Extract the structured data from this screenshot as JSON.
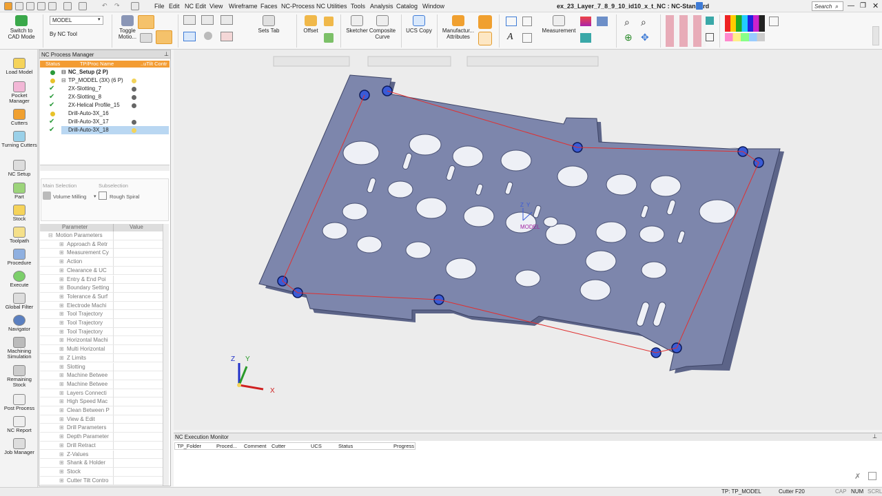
{
  "titlebar": {
    "menu": [
      "File",
      "Edit",
      "NC Edit",
      "View",
      "Wireframe",
      "Faces",
      "NC-Process",
      "NC Utilities",
      "Tools",
      "Analysis",
      "Catalog",
      "Window"
    ],
    "title": "ex_23_Layer_7_8_9_10_id10_x_t_NC : NC-Standard",
    "search_placeholder": "Search"
  },
  "ribbon": {
    "switch_cad": "Switch to CAD Mode",
    "model_select": "MODEL",
    "by_nc_tool": "By NC Tool",
    "toggle_motion": "Toggle Motio...",
    "sets_tab": "Sets Tab",
    "offset": "Offset",
    "sketcher": "Sketcher",
    "composite_curve": "Composite Curve",
    "ucs_copy": "UCS Copy",
    "manufacturing_attributes": "Manufactur... Attributes",
    "measurement": "Measurement"
  },
  "leftbar": [
    "Load Model",
    "Pocket Manager",
    "Cutters",
    "Turning Cutters",
    "NC Setup",
    "Part",
    "Stock",
    "Toolpath",
    "Procedure",
    "Execute",
    "Global Filter",
    "Navigator",
    "Machining Simulation",
    "Remaining Stock",
    "Post Process",
    "NC Report",
    "Job Manager"
  ],
  "process_manager": {
    "title": "NC Process Manager",
    "columns": [
      "Status",
      "TP/Proc Name",
      "..uTilt Contr"
    ],
    "rows": [
      "NC_Setup (2 P)",
      "TP_MODEL (3X) (6 P)",
      "2X-Slotting_7",
      "2X-Slotting_8",
      "2X-Helical Profile_15",
      "Drill-Auto-3X_16",
      "Drill-Auto-3X_17",
      "Drill-Auto-3X_18"
    ]
  },
  "selection": {
    "main_label": "Main Selection",
    "main_value": "Volume Milling",
    "sub_label": "Subselection",
    "sub_value": "Rough Spiral"
  },
  "params": {
    "columns": [
      "Parameter",
      "Value"
    ],
    "items": [
      "Motion Parameters",
      "Approach & Retr",
      "Measurement Cy",
      "Action",
      "Clearance & UC",
      "Entry & End Poi",
      "Boundary Setting",
      "Tolerance & Surf",
      "Electrode Machi",
      "Tool Trajectory",
      "Tool Trajectory",
      "Tool Trajectory",
      "Horizontal Machi",
      "Multi Horizontal",
      "Z Limits",
      "Slotting",
      "Machine Betwee",
      "Machine Betwee",
      "Layers Connecti",
      "High Speed Mac",
      "Clean Between P",
      "View & Edit",
      "Drill Parameters",
      "Depth Parameter",
      "Drill Retract",
      "Z-Values",
      "Shank & Holder",
      "Stock",
      "Cutter Tilt Contro"
    ]
  },
  "viewport": {
    "triad": {
      "x": "X",
      "y": "Y",
      "z": "Z"
    },
    "ucs_label": "MODEL"
  },
  "monitor": {
    "title": "NC Execution Monitor",
    "columns": [
      "TP_Folder",
      "Proced...",
      "Comment",
      "Cutter",
      "UCS",
      "Status",
      "Progress"
    ]
  },
  "statusbar": {
    "tp": "TP: TP_MODEL",
    "cutter": "Cutter  F20",
    "cap": "CAP",
    "num": "NUM",
    "scrl": "SCRL"
  },
  "colors": {
    "plate": "#7d86ac",
    "accent": "#f0a030",
    "select": "#b9d7f2",
    "header_orange": "#f39c33"
  }
}
